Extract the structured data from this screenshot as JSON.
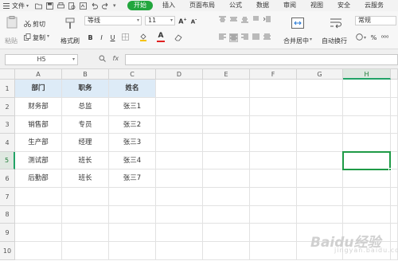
{
  "menubar": {
    "file_label": "文件",
    "tabs": [
      {
        "label": "开始",
        "active": true
      },
      {
        "label": "插入",
        "active": false
      },
      {
        "label": "页面布局",
        "active": false
      },
      {
        "label": "公式",
        "active": false
      },
      {
        "label": "数据",
        "active": false
      },
      {
        "label": "审阅",
        "active": false
      },
      {
        "label": "视图",
        "active": false
      },
      {
        "label": "安全",
        "active": false
      },
      {
        "label": "云服务",
        "active": false
      }
    ]
  },
  "ribbon": {
    "paste_label": "粘贴",
    "cut_label": "剪切",
    "copy_label": "复制",
    "format_painter_label": "格式刷",
    "font_name": "等线",
    "font_size": "11",
    "merge_center_label": "合并居中",
    "wrap_text_label": "自动换行",
    "number_format": "常规",
    "accent_color": "#22a63d"
  },
  "formula_bar": {
    "name_box": "H5",
    "fx_label": "fx",
    "formula_value": ""
  },
  "sheet": {
    "columns": [
      "A",
      "B",
      "C",
      "D",
      "E",
      "F",
      "G",
      "H"
    ],
    "rows": [
      "1",
      "2",
      "3",
      "4",
      "5",
      "6",
      "7",
      "8",
      "9",
      "10"
    ],
    "selected_column": "H",
    "selected_row": "5",
    "data": [
      [
        "部门",
        "职务",
        "姓名"
      ],
      [
        "财务部",
        "总监",
        "张三1"
      ],
      [
        "销售部",
        "专员",
        "张三2"
      ],
      [
        "生产部",
        "经理",
        "张三3"
      ],
      [
        "测试部",
        "班长",
        "张三4"
      ],
      [
        "后勤部",
        "班长",
        "张三7"
      ]
    ],
    "header_fill": "#ddebf7",
    "selection_color": "#1e9a46"
  },
  "watermark": {
    "text": "Baidu经验",
    "sub": "jingyan.baidu.com"
  }
}
